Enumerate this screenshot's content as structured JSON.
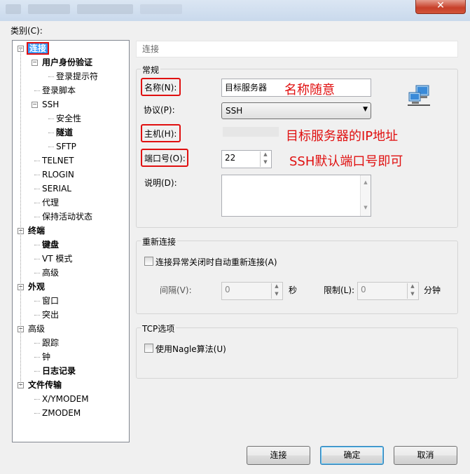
{
  "window": {
    "close_glyph": "✕"
  },
  "category_label": "类别(C):",
  "tree": [
    {
      "label": "连接",
      "bold": true,
      "selected": true,
      "level": 0,
      "toggle": "−"
    },
    {
      "label": "用户身份验证",
      "bold": true,
      "level": 1,
      "toggle": "−"
    },
    {
      "label": "登录提示符",
      "bold": false,
      "level": 2
    },
    {
      "label": "登录脚本",
      "bold": false,
      "level": 1
    },
    {
      "label": "SSH",
      "bold": false,
      "level": 1,
      "toggle": "−"
    },
    {
      "label": "安全性",
      "bold": false,
      "level": 2
    },
    {
      "label": "隧道",
      "bold": true,
      "level": 2
    },
    {
      "label": "SFTP",
      "bold": false,
      "level": 2
    },
    {
      "label": "TELNET",
      "bold": false,
      "level": 1
    },
    {
      "label": "RLOGIN",
      "bold": false,
      "level": 1
    },
    {
      "label": "SERIAL",
      "bold": false,
      "level": 1
    },
    {
      "label": "代理",
      "bold": false,
      "level": 1
    },
    {
      "label": "保持活动状态",
      "bold": false,
      "level": 1
    },
    {
      "label": "终端",
      "bold": true,
      "level": 0,
      "toggle": "−"
    },
    {
      "label": "键盘",
      "bold": true,
      "level": 1
    },
    {
      "label": "VT 模式",
      "bold": false,
      "level": 1
    },
    {
      "label": "高级",
      "bold": false,
      "level": 1
    },
    {
      "label": "外观",
      "bold": true,
      "level": 0,
      "toggle": "−"
    },
    {
      "label": "窗口",
      "bold": false,
      "level": 1
    },
    {
      "label": "突出",
      "bold": false,
      "level": 1
    },
    {
      "label": "高级",
      "bold": false,
      "level": 0,
      "toggle": "−"
    },
    {
      "label": "跟踪",
      "bold": false,
      "level": 1
    },
    {
      "label": "钟",
      "bold": false,
      "level": 1
    },
    {
      "label": "日志记录",
      "bold": true,
      "level": 1
    },
    {
      "label": "文件传输",
      "bold": true,
      "level": 0,
      "toggle": "−"
    },
    {
      "label": "X/YMODEM",
      "bold": false,
      "level": 1
    },
    {
      "label": "ZMODEM",
      "bold": false,
      "level": 1
    }
  ],
  "panel": {
    "header": "连接",
    "general": {
      "title": "常规",
      "name_label": "名称(N):",
      "name_value": "目标服务器",
      "protocol_label": "协议(P):",
      "protocol_value": "SSH",
      "host_label": "主机(H):",
      "port_label": "端口号(O):",
      "port_value": "22",
      "desc_label": "说明(D):"
    },
    "reconnect": {
      "title": "重新连接",
      "checkbox_label": "连接异常关闭时自动重新连接(A)",
      "interval_label": "间隔(V):",
      "interval_value": "0",
      "interval_unit": "秒",
      "limit_label": "限制(L):",
      "limit_value": "0",
      "limit_unit": "分钟"
    },
    "tcp": {
      "title": "TCP选项",
      "nagle_label": "使用Nagle算法(U)"
    }
  },
  "annotations": {
    "name_note": "名称随意",
    "host_note": "目标服务器的IP地址",
    "port_note": "SSH默认端口号即可"
  },
  "buttons": {
    "connect": "连接",
    "ok": "确定",
    "cancel": "取消"
  },
  "colors": {
    "annotation_red": "#e01010",
    "selection_blue": "#3399ff"
  },
  "icons": {
    "network": "network-computer-icon",
    "dropdown": "▼",
    "spin_up": "▲",
    "spin_down": "▼"
  }
}
